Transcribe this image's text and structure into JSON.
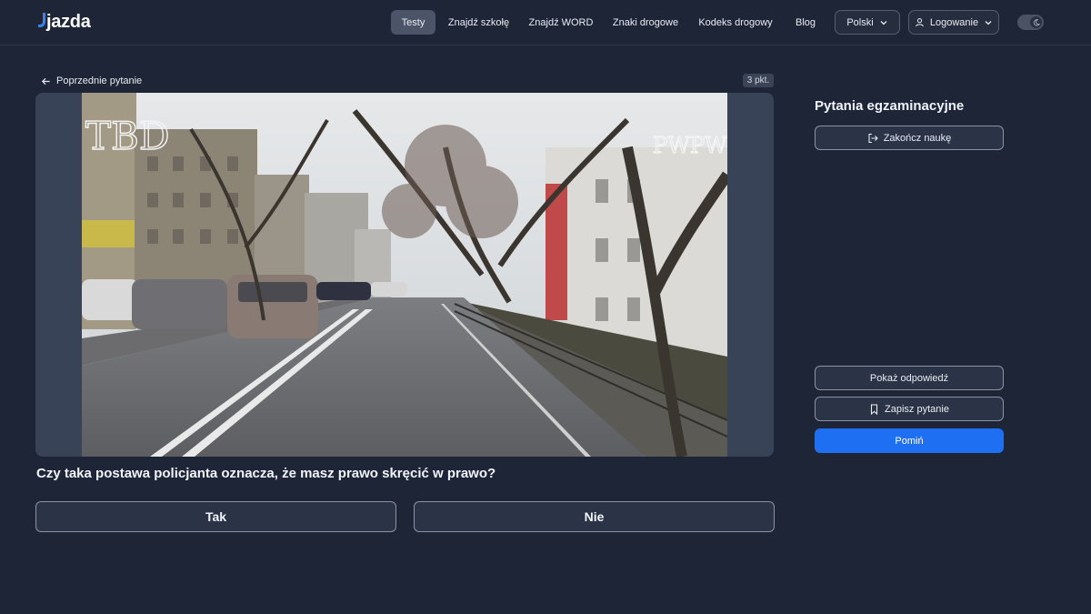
{
  "header": {
    "logo": "jazda",
    "nav": [
      {
        "label": "Testy",
        "active": true
      },
      {
        "label": "Znajdź szkołę",
        "active": false
      },
      {
        "label": "Znajdź WORD",
        "active": false
      },
      {
        "label": "Znaki drogowe",
        "active": false
      },
      {
        "label": "Kodeks drogowy",
        "active": false
      },
      {
        "label": "Blog",
        "active": false
      }
    ],
    "language": "Polski",
    "login": "Logowanie",
    "theme_toggle_icon": "moon-icon"
  },
  "main": {
    "prev_link": "Poprzednie pytanie",
    "points": "3 pkt.",
    "media": {
      "watermark_left": "TBD",
      "watermark_right": "PWPW"
    },
    "question": "Czy taka postawa policjanta oznacza, że masz prawo skręcić w prawo?",
    "answers": [
      "Tak",
      "Nie"
    ]
  },
  "sidebar": {
    "title": "Pytania egzaminacyjne",
    "finish_button": "Zakończ naukę",
    "show_answer_button": "Pokaż odpowiedź",
    "save_button": "Zapisz pytanie",
    "skip_button": "Pomiń"
  },
  "colors": {
    "background": "#1e2536",
    "accent": "#1f6ff2",
    "logo_accent": "#3b82f6"
  }
}
